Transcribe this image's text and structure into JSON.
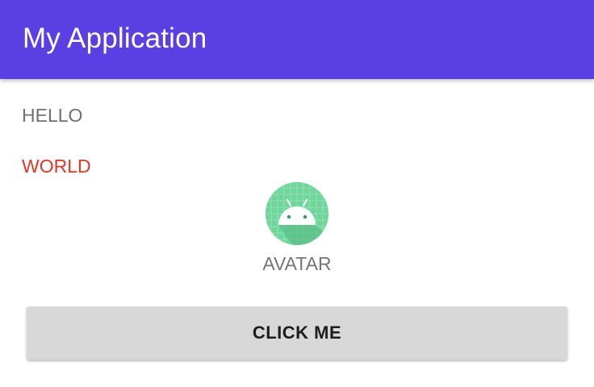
{
  "app_bar": {
    "title": "My Application",
    "color": "#5a40e3"
  },
  "content": {
    "hello_text": "HELLO",
    "world_text": "WORLD",
    "world_color": "#e53526",
    "avatar": {
      "icon": "android-icon",
      "label": "AVATAR"
    },
    "button_label": "CLICK ME"
  }
}
